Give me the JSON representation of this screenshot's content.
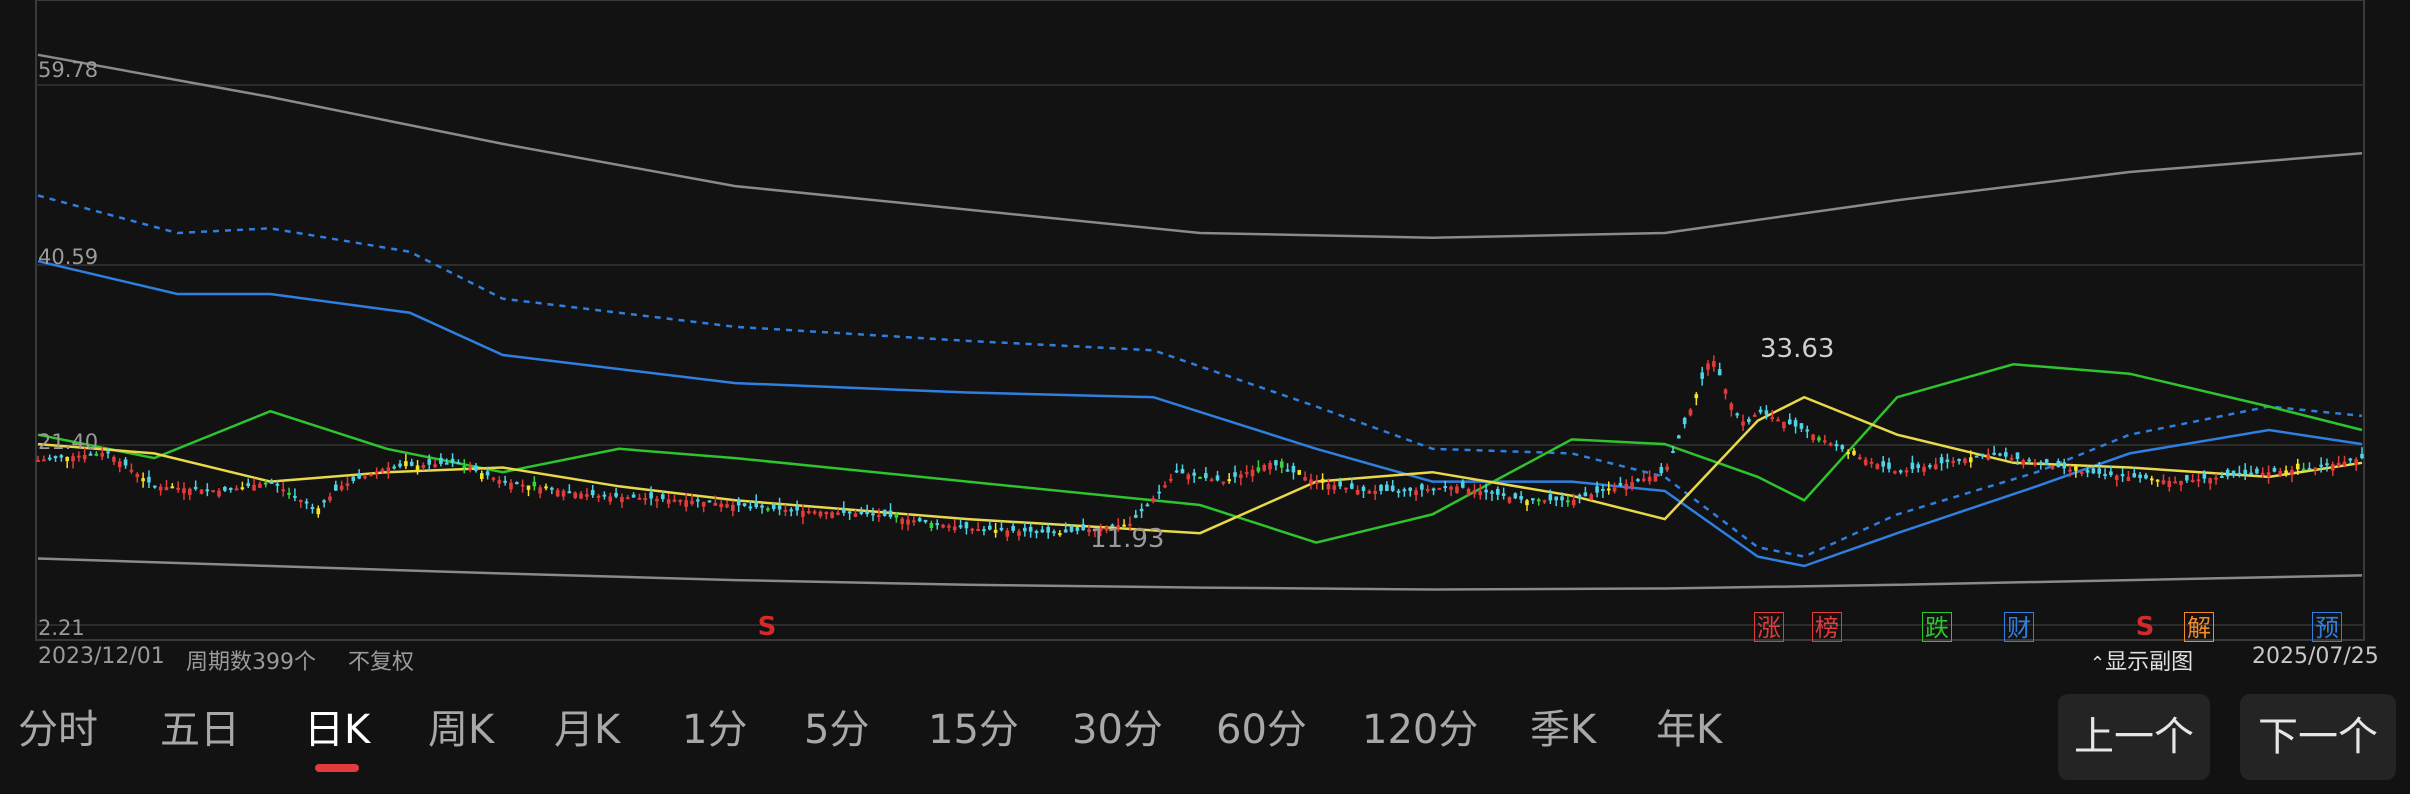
{
  "chart": {
    "price_high_label": "59.78",
    "price_mid_label": "40.59",
    "price_low_label": "21.40",
    "price_bottom_label": "2.21",
    "max_price_annotation": "33.63",
    "min_price_annotation": "11.93",
    "start_date": "2023/12/01",
    "end_date": "2025/07/25",
    "period_count": "周期数399个",
    "adjust_mode": "不复权",
    "show_subchart": "显示副图",
    "subchart_icon": "double-chevron-up-icon",
    "colors": {
      "background": "#121212",
      "up": "#e23b3b",
      "down": "#4fd2e6",
      "yellow_candle": "#f5e02a",
      "green_candle": "#3ad23a",
      "ma_white": "#8a8a8a",
      "ma_blue": "#2f7fe0",
      "ma_green": "#2ec42e",
      "ma_yellow": "#e8d84a"
    },
    "markers": [
      {
        "label": "S",
        "color": "#d42a2a",
        "style": "plain"
      },
      {
        "label": "涨",
        "color": "#e23b3b",
        "style": "box"
      },
      {
        "label": "榜",
        "color": "#e23b3b",
        "style": "box"
      },
      {
        "label": "跌",
        "color": "#2ec42e",
        "style": "box"
      },
      {
        "label": "财",
        "color": "#2f7fe0",
        "style": "box"
      },
      {
        "label": "S",
        "color": "#d42a2a",
        "style": "plain"
      },
      {
        "label": "解",
        "color": "#f08a2a",
        "style": "box"
      },
      {
        "label": "预",
        "color": "#2f7fe0",
        "style": "box"
      }
    ]
  },
  "chart_data": {
    "type": "line",
    "title": "",
    "ylim": [
      2.21,
      59.78
    ],
    "x_range": [
      "2023/12/01",
      "2025/07/25"
    ],
    "y_ticks": [
      59.78,
      40.59,
      21.4,
      2.21
    ],
    "grid": true,
    "legend": "none",
    "annotations": [
      {
        "text": "33.63",
        "meaning": "period high"
      },
      {
        "text": "11.93",
        "meaning": "period low"
      }
    ],
    "series": [
      {
        "color": "#8a8a8a",
        "x": [
          0,
          10,
          20,
          30,
          40,
          50,
          60,
          70,
          80,
          90,
          100
        ],
        "y": [
          63.0,
          58.5,
          53.5,
          49.0,
          46.5,
          44.0,
          43.5,
          44.0,
          47.5,
          50.5,
          52.5
        ]
      },
      {
        "color": "#8a8a8a",
        "x": [
          0,
          10,
          20,
          30,
          40,
          50,
          60,
          70,
          80,
          90,
          100
        ],
        "y": [
          9.3,
          8.5,
          7.7,
          7.0,
          6.5,
          6.2,
          6.0,
          6.1,
          6.5,
          7.0,
          7.5
        ]
      },
      {
        "color": "#2f7fe0",
        "style": "dashed",
        "x": [
          0,
          6,
          10,
          16,
          20,
          30,
          40,
          48,
          55,
          60,
          66,
          70,
          74,
          76,
          80,
          86,
          90,
          96,
          100
        ],
        "y": [
          48.0,
          44.0,
          44.5,
          42.0,
          37.0,
          34.0,
          32.5,
          31.5,
          25.5,
          21.0,
          20.5,
          18.0,
          10.5,
          9.5,
          14.0,
          18.5,
          22.5,
          25.5,
          24.5
        ]
      },
      {
        "color": "#2f7fe0",
        "x": [
          0,
          6,
          10,
          16,
          20,
          30,
          40,
          48,
          55,
          60,
          66,
          70,
          74,
          76,
          80,
          86,
          90,
          96,
          100
        ],
        "y": [
          41.0,
          37.5,
          37.5,
          35.5,
          31.0,
          28.0,
          27.0,
          26.5,
          21.0,
          17.5,
          17.5,
          16.5,
          9.5,
          8.5,
          12.0,
          17.0,
          20.5,
          23.0,
          21.5
        ]
      },
      {
        "color": "#2ec42e",
        "x": [
          0,
          5,
          10,
          15,
          20,
          25,
          30,
          40,
          50,
          55,
          60,
          66,
          70,
          74,
          76,
          80,
          85,
          90,
          96,
          100
        ],
        "y": [
          22.5,
          20.0,
          25.0,
          21.0,
          18.5,
          21.0,
          20.0,
          17.5,
          15.0,
          11.0,
          14.0,
          22.0,
          21.5,
          18.0,
          15.5,
          26.5,
          30.0,
          29.0,
          25.5,
          23.0
        ]
      },
      {
        "color": "#e8d84a",
        "x": [
          0,
          5,
          10,
          15,
          20,
          25,
          30,
          40,
          50,
          55,
          60,
          66,
          70,
          74,
          76,
          80,
          85,
          90,
          96,
          100
        ],
        "y": [
          21.5,
          20.5,
          17.5,
          18.5,
          19.0,
          17.0,
          15.5,
          13.5,
          12.0,
          17.5,
          18.5,
          16.0,
          13.5,
          24.0,
          26.5,
          22.5,
          19.5,
          19.0,
          18.0,
          19.5
        ]
      },
      {
        "name": "price",
        "color": "#4fd2e6",
        "x": [
          0,
          3,
          5,
          8,
          10,
          12,
          13,
          15,
          18,
          20,
          24,
          28,
          32,
          36,
          40,
          44,
          47,
          49,
          51,
          53,
          55,
          57,
          59,
          61,
          64,
          66,
          68,
          70,
          71,
          72,
          73,
          73.5,
          74,
          76,
          78,
          80,
          82,
          84,
          86,
          88,
          90,
          92,
          94,
          96,
          98,
          100
        ],
        "y": [
          19.8,
          20.6,
          17.0,
          16.5,
          17.5,
          14.5,
          17.0,
          19.0,
          19.5,
          17.5,
          16.0,
          15.5,
          14.5,
          14.0,
          12.5,
          12.0,
          13.0,
          18.5,
          17.5,
          19.5,
          17.5,
          16.5,
          16.5,
          17.0,
          15.5,
          15.5,
          17.0,
          18.5,
          24.5,
          31.0,
          25.0,
          23.5,
          25.0,
          23.0,
          20.5,
          18.5,
          19.5,
          20.5,
          19.5,
          18.5,
          18.0,
          17.5,
          18.0,
          18.5,
          19.0,
          20.0
        ]
      }
    ]
  },
  "toolbar": {
    "tabs": [
      "分时",
      "五日",
      "日K",
      "周K",
      "月K",
      "1分",
      "5分",
      "15分",
      "30分",
      "60分",
      "120分",
      "季K",
      "年K"
    ],
    "active_tab": "日K",
    "prev_button": "上一个",
    "next_button": "下一个"
  }
}
